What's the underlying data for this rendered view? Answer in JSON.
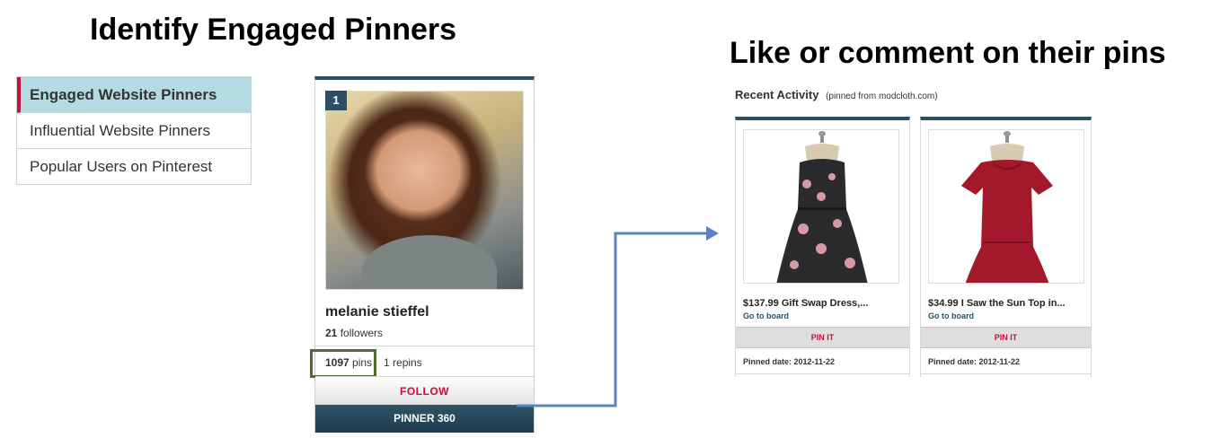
{
  "headings": {
    "left": "Identify Engaged Pinners",
    "right": "Like or comment on their pins"
  },
  "menu": {
    "items": [
      {
        "label": "Engaged Website Pinners",
        "active": true
      },
      {
        "label": "Influential Website Pinners",
        "active": false
      },
      {
        "label": "Popular Users on Pinterest",
        "active": false
      }
    ]
  },
  "pinner": {
    "rank": "1",
    "name": "melanie stieffel",
    "followers_count": "21",
    "followers_label": "followers",
    "pins_count": "1097",
    "pins_label": "pins",
    "repins_count": "1",
    "repins_label": "repins",
    "follow_label": "FOLLOW",
    "pinner360_label": "PINNER 360"
  },
  "recent_activity": {
    "title": "Recent Activity",
    "source": "(pinned from modcloth.com)",
    "pins": [
      {
        "title": "$137.99 Gift Swap Dress,...",
        "board_link": "Go to board",
        "pin_it": "PIN IT",
        "pinned_date": "Pinned date: 2012-11-22",
        "dress_color": "#2b2a2c"
      },
      {
        "title": "$34.99 I Saw the Sun Top in...",
        "board_link": "Go to board",
        "pin_it": "PIN IT",
        "pinned_date": "Pinned date: 2012-11-22",
        "dress_color": "#a3192b"
      }
    ]
  },
  "colors": {
    "accent_red": "#c8103e",
    "header_navy": "#2c4f65",
    "active_bg": "#b4dae2",
    "highlight_green": "#4f6b2e",
    "arrow_blue": "#5b83c0"
  }
}
